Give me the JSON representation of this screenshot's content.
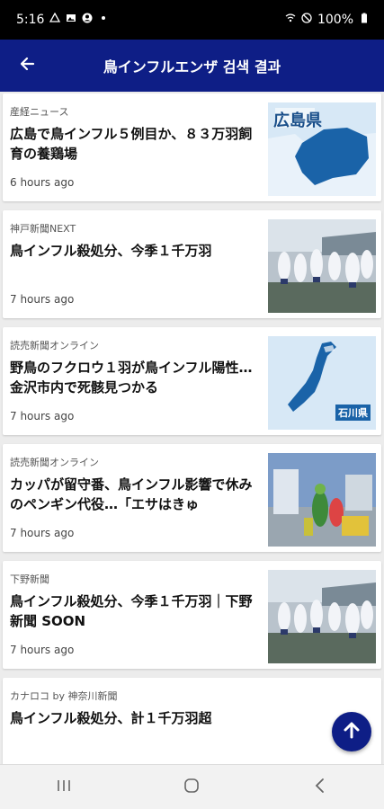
{
  "status_bar": {
    "time": "5:16",
    "battery": "100%"
  },
  "header": {
    "title": "鳥インフルエンザ 검색 결과",
    "back_icon": "arrow-left-icon"
  },
  "articles": [
    {
      "source": "産経ニュース",
      "headline": "広島で鳥インフル５例目か、８３万羽飼育の養鶏場",
      "time": "6 hours ago",
      "thumb": "map-hiroshima",
      "thumb_label": "広島県"
    },
    {
      "source": "神戸新聞NEXT",
      "headline": "鳥インフル殺処分、今季１千万羽",
      "time": "7 hours ago",
      "thumb": "workers-photo"
    },
    {
      "source": "読売新聞オンライン",
      "headline": "野鳥のフクロウ１羽が鳥インフル陽性…金沢市内で死骸見つかる",
      "time": "7 hours ago",
      "thumb": "map-ishikawa",
      "thumb_label": "石川県"
    },
    {
      "source": "読売新聞オンライン",
      "headline": "カッパが留守番、鳥インフル影響で休みのペンギン代役…「エサはきゅ",
      "time": "7 hours ago",
      "thumb": "kappa-photo"
    },
    {
      "source": "下野新聞",
      "headline": "鳥インフル殺処分、今季１千万羽｜下野新聞 SOON",
      "time": "7 hours ago",
      "thumb": "workers-photo"
    },
    {
      "source": "カナロコ by 神奈川新聞",
      "headline": "鳥インフル殺処分、計１千万羽超",
      "time": "",
      "thumb": ""
    }
  ],
  "fab_icon": "arrow-up-icon",
  "nav": {
    "recents_icon": "recents-icon",
    "home_icon": "home-icon",
    "back_icon": "back-chevron-icon"
  },
  "colors": {
    "app_bar": "#0e1e86",
    "map_land": "#1a63a8",
    "map_bg": "#d7e8f6"
  }
}
